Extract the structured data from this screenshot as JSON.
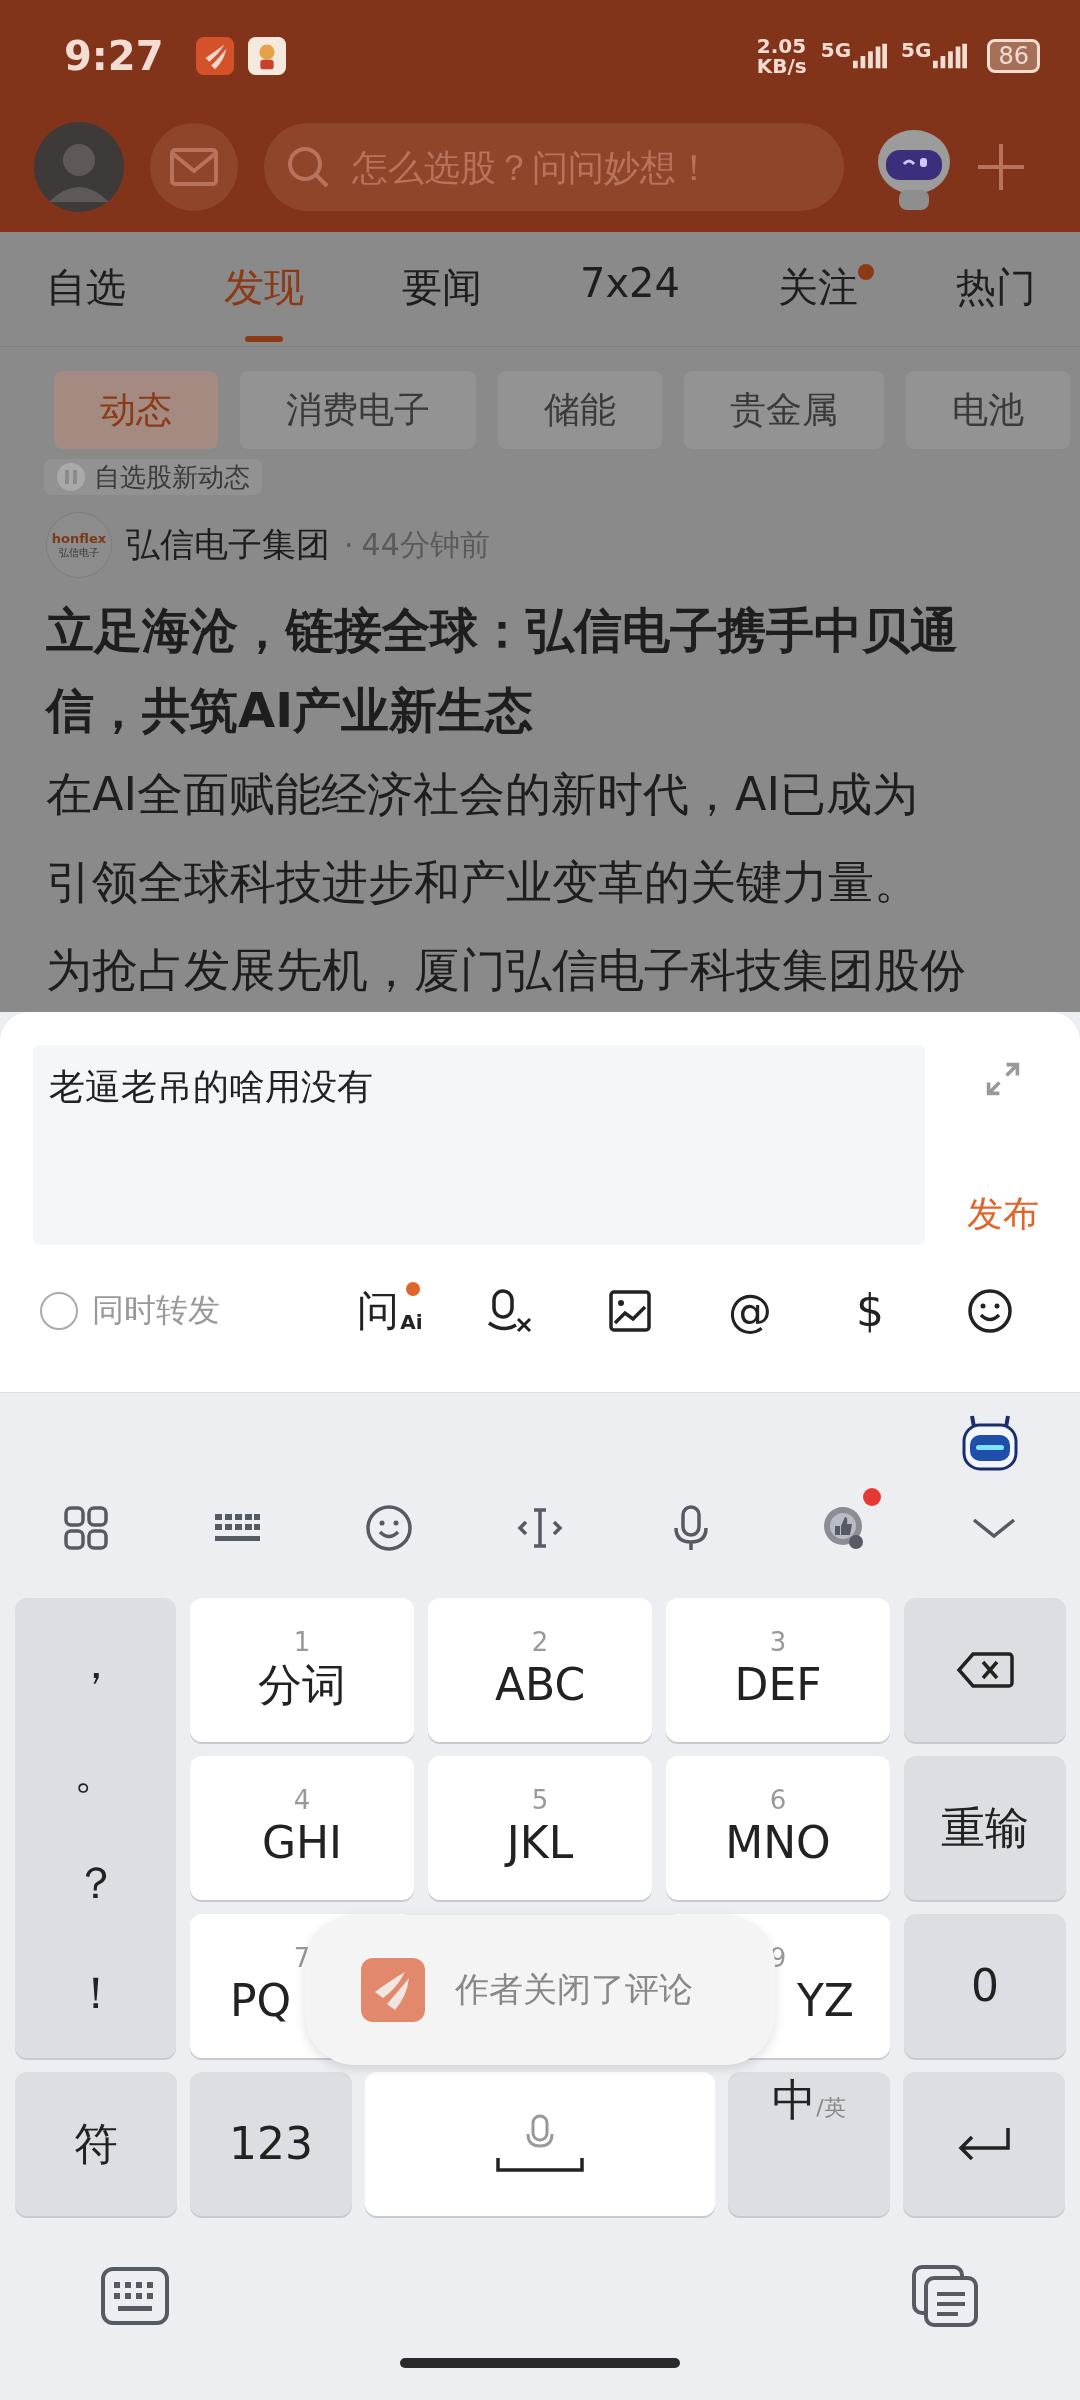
{
  "status_bar": {
    "time": "9:27",
    "net_speed": "2.05",
    "net_unit": "KB/s",
    "sim1": "5G",
    "sim2": "5G",
    "battery": "86"
  },
  "header": {
    "search_placeholder": "怎么选股？问问妙想！"
  },
  "tabs": [
    {
      "label": "自选",
      "selected": false,
      "dot": false
    },
    {
      "label": "发现",
      "selected": true,
      "dot": false
    },
    {
      "label": "要闻",
      "selected": false,
      "dot": false
    },
    {
      "label": "7x24",
      "selected": false,
      "dot": false
    },
    {
      "label": "关注",
      "selected": false,
      "dot": true
    },
    {
      "label": "热门",
      "selected": false,
      "dot": false
    }
  ],
  "chips": [
    {
      "label": "动态",
      "selected": true
    },
    {
      "label": "消费电子",
      "selected": false
    },
    {
      "label": "储能",
      "selected": false
    },
    {
      "label": "贵金属",
      "selected": false
    },
    {
      "label": "电池",
      "selected": false
    }
  ],
  "feed": {
    "tag": "自选股新动态",
    "logo_text": "honflex",
    "logo_sub": "弘信电子",
    "source": "弘信电子集团",
    "separator": "·",
    "time": "44分钟前",
    "title": "立足海沧，链接全球：弘信电子携手中贝通信，共筑AI产业新生态",
    "body": [
      "在AI全面赋能经济社会的新时代，AI已成为",
      "引领全球科技进步和产业变革的关键力量。",
      "为抢占发展先机，厦门弘信电子科技集团股份"
    ]
  },
  "composer": {
    "value": "老逼老吊的啥用没有",
    "submit": "发布",
    "repost_label": "同时转发",
    "repost_checked": false,
    "tools": [
      {
        "kind": "ai",
        "label": "问",
        "sub": "Ai",
        "dot": true
      },
      {
        "kind": "voice",
        "dot": false
      },
      {
        "kind": "image",
        "dot": false
      },
      {
        "kind": "char",
        "label": "@",
        "dot": false
      },
      {
        "kind": "char",
        "label": "$",
        "dot": false
      },
      {
        "kind": "emoji",
        "dot": false
      }
    ]
  },
  "keyboard": {
    "toolbar": [
      {
        "kind": "grid",
        "dot": false
      },
      {
        "kind": "keyboard",
        "dot": false
      },
      {
        "kind": "emoji",
        "dot": false
      },
      {
        "kind": "cursor",
        "dot": false
      },
      {
        "kind": "mic",
        "dot": false
      },
      {
        "kind": "badge",
        "dot": true
      },
      {
        "kind": "collapse",
        "dot": false
      }
    ],
    "punctuation": [
      "，",
      "。",
      "？",
      "！"
    ],
    "rows": [
      [
        {
          "num": "1",
          "label": "分词"
        },
        {
          "num": "2",
          "label": "ABC"
        },
        {
          "num": "3",
          "label": "DEF"
        }
      ],
      [
        {
          "num": "4",
          "label": "GHI"
        },
        {
          "num": "5",
          "label": "JKL"
        },
        {
          "num": "6",
          "label": "MNO"
        }
      ],
      [
        {
          "num": "7",
          "label": "PQ"
        },
        null,
        {
          "num": "9",
          "label": "YZ"
        }
      ]
    ],
    "side": [
      {
        "kind": "backspace"
      },
      {
        "kind": "text",
        "label": "重输"
      },
      {
        "kind": "text",
        "label": "0"
      }
    ],
    "bottom": [
      {
        "kind": "text",
        "label": "符"
      },
      {
        "kind": "text",
        "label": "123"
      },
      {
        "kind": "space"
      },
      {
        "kind": "lang",
        "label": "中",
        "sub": "/英"
      },
      {
        "kind": "enter"
      }
    ]
  },
  "toast": {
    "text": "作者关闭了评论"
  }
}
